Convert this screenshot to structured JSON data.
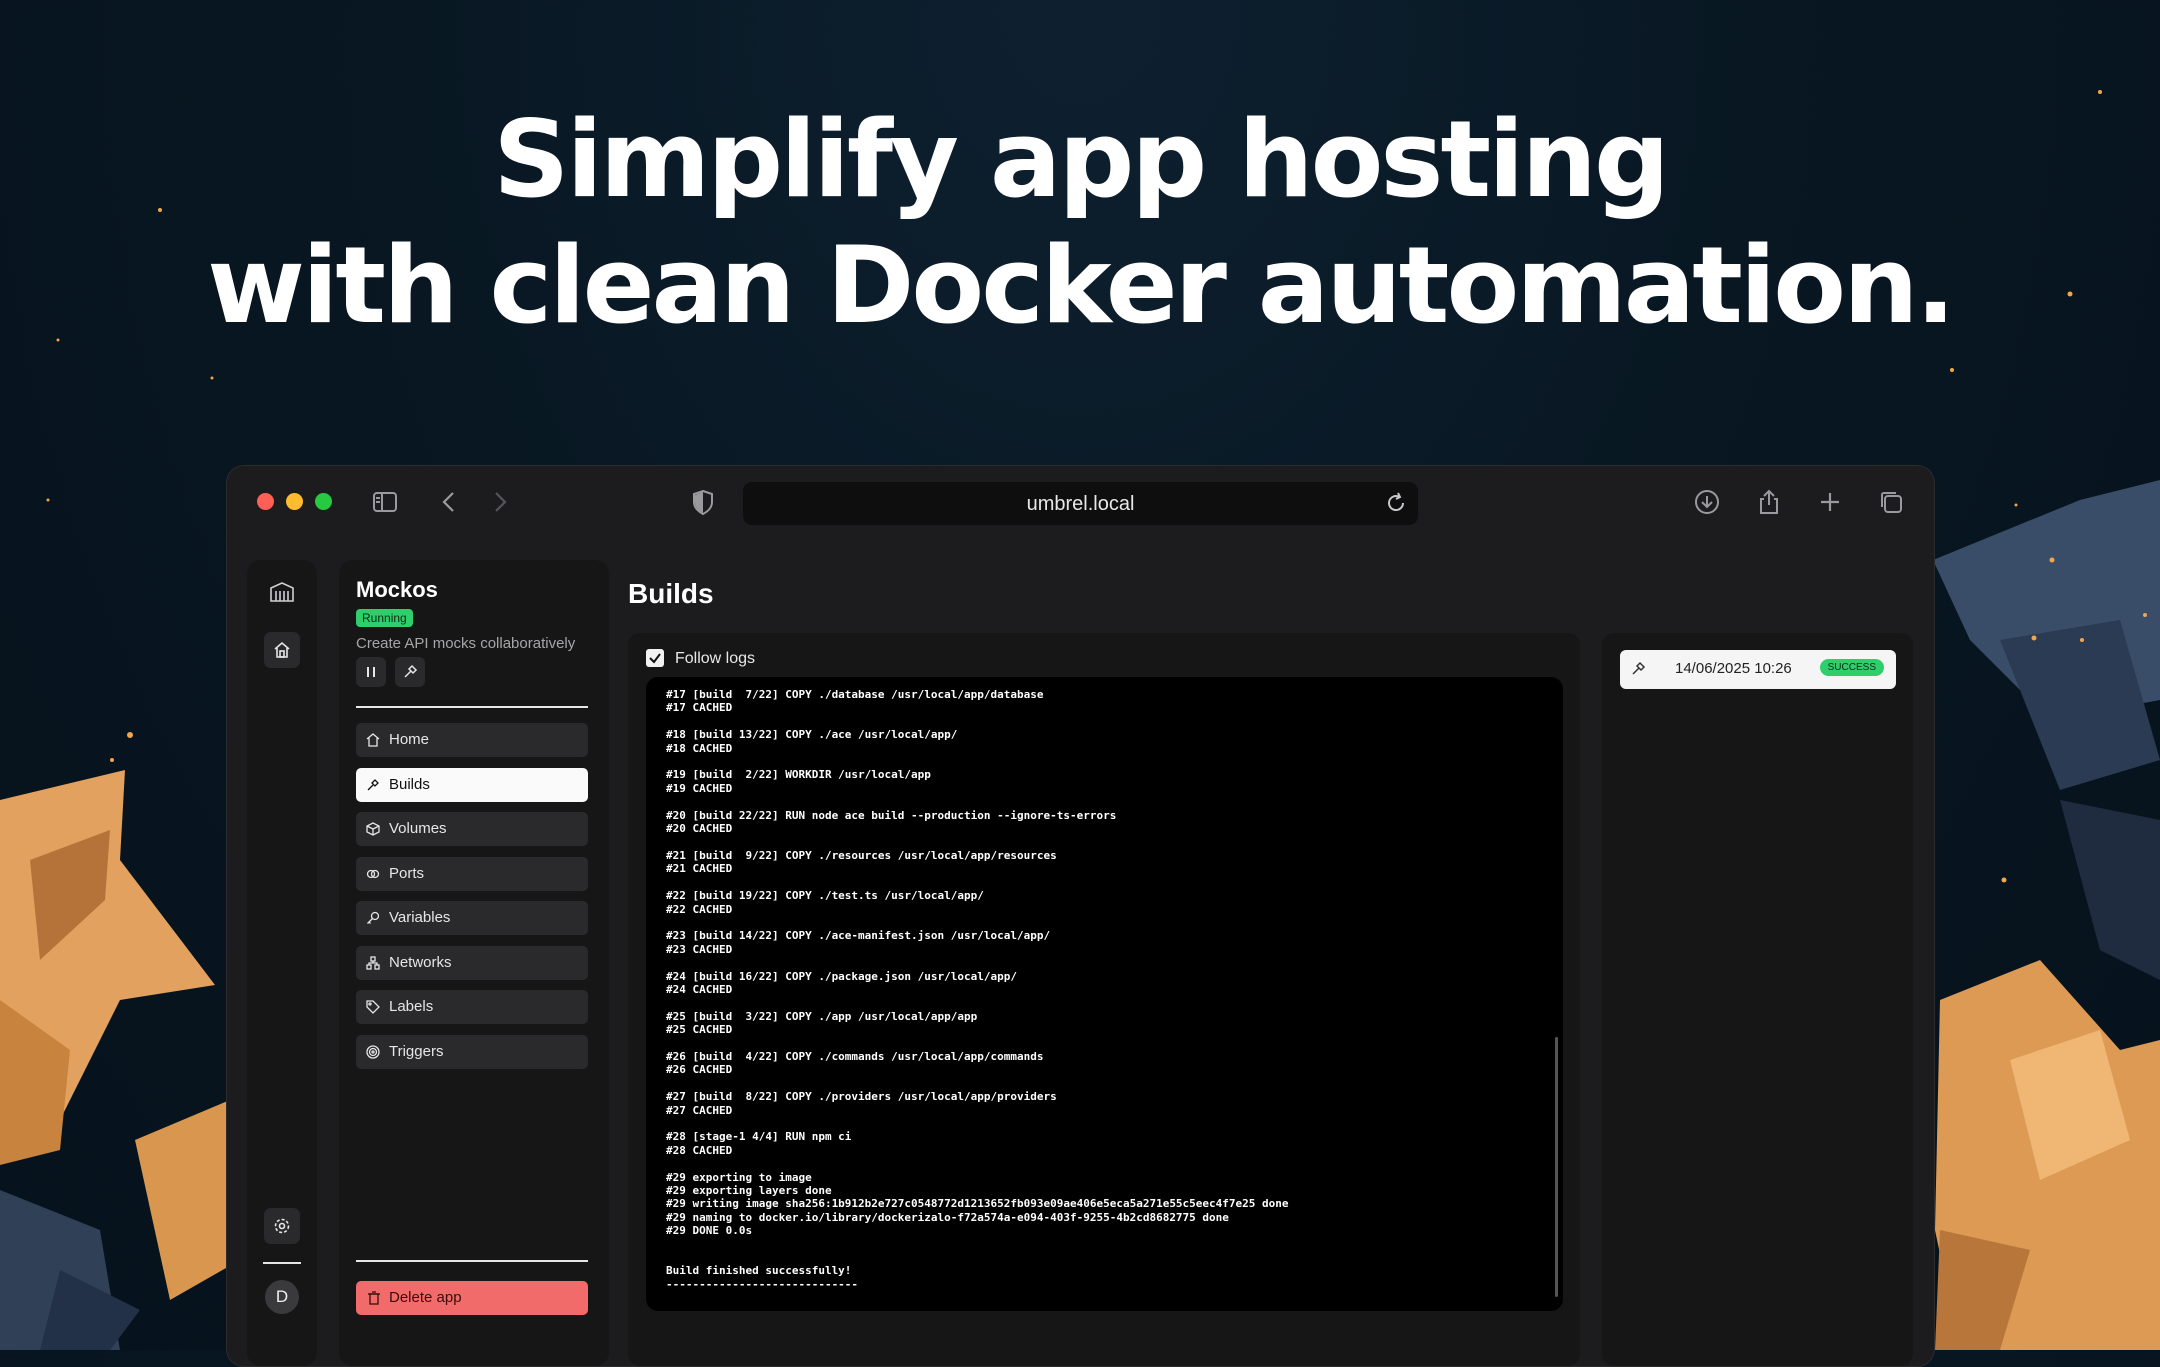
{
  "headline": {
    "line1": "Simplify app hosting",
    "line2": "with clean Docker automation."
  },
  "browser": {
    "url": "umbrel.local"
  },
  "app": {
    "name": "Mockos",
    "status": "Running",
    "description": "Create API mocks collaboratively"
  },
  "nav": {
    "items": [
      {
        "label": "Home",
        "icon": "home-icon"
      },
      {
        "label": "Builds",
        "icon": "hammer-icon"
      },
      {
        "label": "Volumes",
        "icon": "box-icon"
      },
      {
        "label": "Ports",
        "icon": "link-icon"
      },
      {
        "label": "Variables",
        "icon": "key-icon"
      },
      {
        "label": "Networks",
        "icon": "network-icon"
      },
      {
        "label": "Labels",
        "icon": "tag-icon"
      },
      {
        "label": "Triggers",
        "icon": "target-icon"
      }
    ],
    "active": "Builds",
    "delete_label": "Delete app"
  },
  "user": {
    "initial": "D"
  },
  "page": {
    "title": "Builds",
    "follow_logs_label": "Follow logs"
  },
  "logs": [
    "#17 [build  7/22] COPY ./database /usr/local/app/database",
    "#17 CACHED",
    "",
    "#18 [build 13/22] COPY ./ace /usr/local/app/",
    "#18 CACHED",
    "",
    "#19 [build  2/22] WORKDIR /usr/local/app",
    "#19 CACHED",
    "",
    "#20 [build 22/22] RUN node ace build --production --ignore-ts-errors",
    "#20 CACHED",
    "",
    "#21 [build  9/22] COPY ./resources /usr/local/app/resources",
    "#21 CACHED",
    "",
    "#22 [build 19/22] COPY ./test.ts /usr/local/app/",
    "#22 CACHED",
    "",
    "#23 [build 14/22] COPY ./ace-manifest.json /usr/local/app/",
    "#23 CACHED",
    "",
    "#24 [build 16/22] COPY ./package.json /usr/local/app/",
    "#24 CACHED",
    "",
    "#25 [build  3/22] COPY ./app /usr/local/app/app",
    "#25 CACHED",
    "",
    "#26 [build  4/22] COPY ./commands /usr/local/app/commands",
    "#26 CACHED",
    "",
    "#27 [build  8/22] COPY ./providers /usr/local/app/providers",
    "#27 CACHED",
    "",
    "#28 [stage-1 4/4] RUN npm ci",
    "#28 CACHED",
    "",
    "#29 exporting to image",
    "#29 exporting layers done",
    "#29 writing image sha256:1b912b2e727c0548772d1213652fb093e09ae406e5eca5a271e55c5eec4f7e25 done",
    "#29 naming to docker.io/library/dockerizalo-f72a574a-e094-403f-9255-4b2cd8682775 done",
    "#29 DONE 0.0s",
    "",
    "",
    "Build finished successfully!",
    "-----------------------------"
  ],
  "builds": [
    {
      "time": "14/06/2025 10:26",
      "status": "SUCCESS"
    }
  ],
  "colors": {
    "success": "#2fce6b",
    "danger": "#f26b6b",
    "traffic_red": "#ff5f57",
    "traffic_yellow": "#febc2e",
    "traffic_green": "#28c840"
  }
}
